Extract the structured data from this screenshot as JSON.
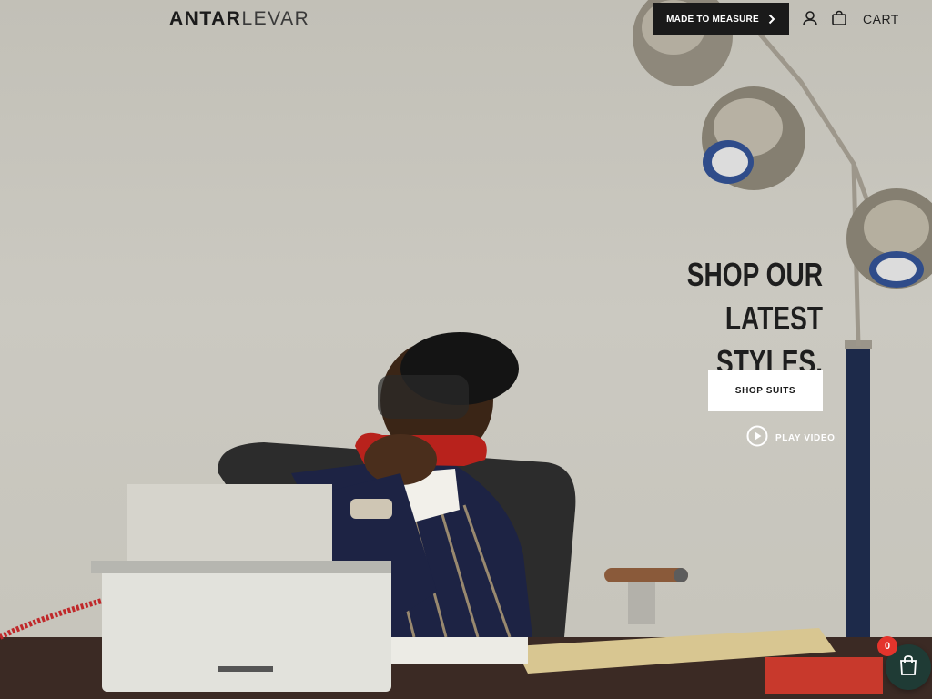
{
  "header": {
    "brand_bold": "ANTAR",
    "brand_light": "LEVAR",
    "made_to_measure": "MADE TO MEASURE",
    "cart_label": "CART"
  },
  "hero": {
    "heading_line1": "SHOP OUR LATEST",
    "heading_line2": "STYLES.",
    "cta_label": "SHOP SUITS",
    "video_label": "PLAY VIDEO"
  },
  "floating_cart": {
    "count": "0"
  },
  "icons": {
    "account": "user-icon",
    "bag": "shopping-bag-icon",
    "play": "play-circle-icon",
    "chevron": "chevron-right-icon"
  },
  "colors": {
    "header_button": "#1a1a1a",
    "floating_cart": "#1f3b35",
    "badge": "#e4342c"
  }
}
